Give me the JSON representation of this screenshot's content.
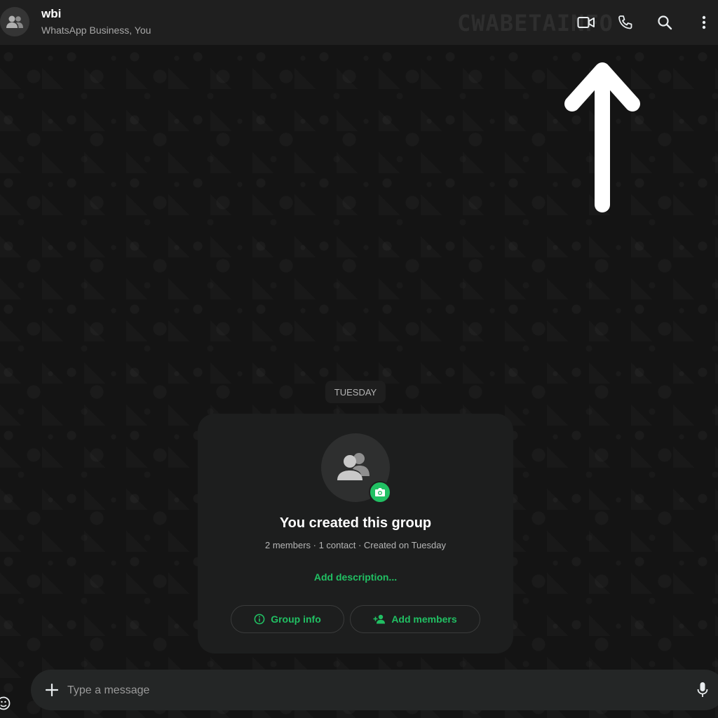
{
  "header": {
    "name": "wbi",
    "subtitle": "WhatsApp Business, You",
    "watermark": "CWABETAINFO",
    "icons": [
      "group-avatar-icon",
      "video-call-icon",
      "voice-call-icon",
      "search-icon",
      "more-options-icon"
    ]
  },
  "chat": {
    "date_label": "TUESDAY"
  },
  "group_card": {
    "title": "You created this group",
    "meta": "2 members · 1 contact · Created on Tuesday",
    "add_description": "Add description...",
    "group_info_label": "Group info",
    "add_members_label": "Add members"
  },
  "composer": {
    "placeholder": "Type a message",
    "value": ""
  },
  "colors": {
    "header_bg": "#1f1f1f",
    "accent_green": "#21c063",
    "card_bg": "#1d1e1e",
    "composer_bg": "#242626"
  }
}
